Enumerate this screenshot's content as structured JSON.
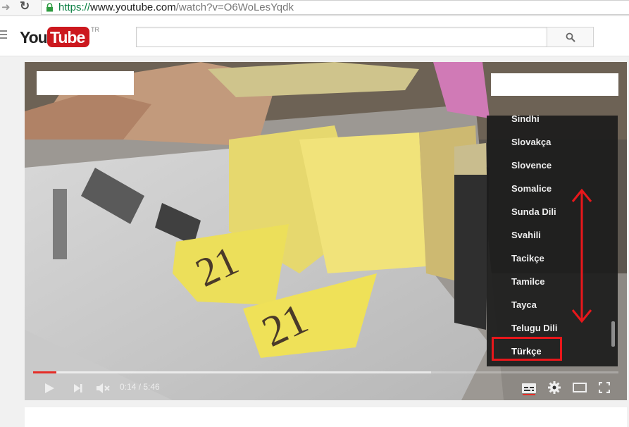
{
  "browser": {
    "url_scheme": "https://",
    "url_host": "www.youtube.com",
    "url_path": "/watch?v=O6WoLesYqdk"
  },
  "header": {
    "logo_you": "You",
    "logo_tube": "Tube",
    "region": "TR",
    "search_value": ""
  },
  "subtitle_menu": {
    "languages": [
      "Sindhi",
      "Slovakça",
      "Slovence",
      "Somalice",
      "Sunda Dili",
      "Svahili",
      "Tacikçe",
      "Tamilce",
      "Tayca",
      "Telugu Dili",
      "Türkçe"
    ],
    "selected": "Türkçe"
  },
  "player": {
    "time_current": "0:14",
    "time_separator": " / ",
    "time_total": "5:46",
    "progress": 0.04,
    "buffered": 0.68
  },
  "colors": {
    "accent": "#e52d27",
    "annotation": "#e8171b",
    "brand": "#cc181e"
  }
}
